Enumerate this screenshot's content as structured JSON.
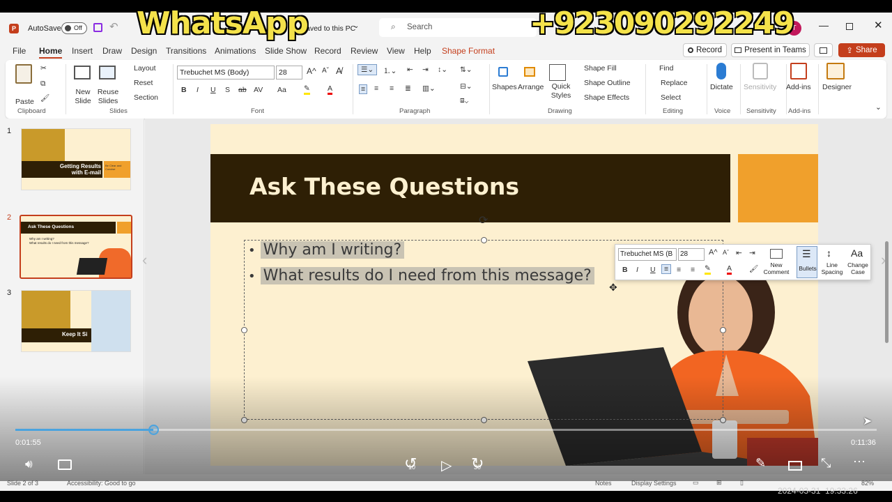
{
  "overlay": {
    "whatsapp": "WhatsApp",
    "phone": "+923090292249"
  },
  "titlebar": {
    "autosave": "AutoSave",
    "autosave_state": "Off",
    "save_status": "Saved to this PC",
    "search_placeholder": "Search",
    "avatar": "T"
  },
  "menu": {
    "tabs": [
      "File",
      "Home",
      "Insert",
      "Draw",
      "Design",
      "Transitions",
      "Animations",
      "Slide Show",
      "Record",
      "Review",
      "View",
      "Help",
      "Shape Format"
    ],
    "record": "Record",
    "present": "Present in Teams",
    "share": "Share"
  },
  "ribbon": {
    "clipboard": {
      "paste": "Paste",
      "label": "Clipboard"
    },
    "slides": {
      "new_slide": "New Slide",
      "reuse": "Reuse Slides",
      "layout": "Layout",
      "reset": "Reset",
      "section": "Section",
      "label": "Slides"
    },
    "font": {
      "name": "Trebuchet MS (Body)",
      "size": "28",
      "label": "Font"
    },
    "paragraph": {
      "label": "Paragraph"
    },
    "drawing": {
      "shapes": "Shapes",
      "arrange": "Arrange",
      "quick_styles": "Quick Styles",
      "fill": "Shape Fill",
      "outline": "Shape Outline",
      "effects": "Shape Effects",
      "label": "Drawing"
    },
    "editing": {
      "find": "Find",
      "replace": "Replace",
      "select": "Select",
      "label": "Editing"
    },
    "voice": {
      "dictate": "Dictate",
      "label": "Voice"
    },
    "sensitivity": {
      "btn": "Sensitivity",
      "label": "Sensitivity"
    },
    "addins": {
      "btn": "Add-ins",
      "label": "Add-ins"
    },
    "designer": {
      "btn": "Designer"
    }
  },
  "thumbnails": [
    {
      "num": "1",
      "title": "Getting Results with E-mail",
      "sub": "Be Clear and Concise"
    },
    {
      "num": "2",
      "title": "Ask These Questions",
      "b1": "Why am I writing?",
      "b2": "What results do I need from this message?"
    },
    {
      "num": "3",
      "title": "Keep It Si"
    }
  ],
  "slide": {
    "title": "Ask These Questions",
    "bullets": [
      "Why am I writing?",
      "What results do I need from this message?"
    ]
  },
  "minitoolbar": {
    "font": "Trebuchet MS (B",
    "size": "28",
    "new_comment": "New Comment",
    "bullets": "Bullets",
    "line_spacing": "Line Spacing",
    "change_case": "Change Case"
  },
  "video": {
    "elapsed": "0:01:55",
    "duration": "0:11:36",
    "progress": 0.16,
    "rew": "10",
    "fwd": "30"
  },
  "status": {
    "slide": "Slide 2 of 3",
    "accessibility": "Accessibility: Good to go",
    "notes": "Notes",
    "display": "Display Settings",
    "zoom": "82%"
  },
  "timestamp": "2024-03-31  19:33:26",
  "colors": {
    "accent": "#c43e1c",
    "slide_bg": "#fdf0d0",
    "title_bar": "#2e1f05",
    "orange": "#f0a02c",
    "progress": "#4aa3df"
  }
}
